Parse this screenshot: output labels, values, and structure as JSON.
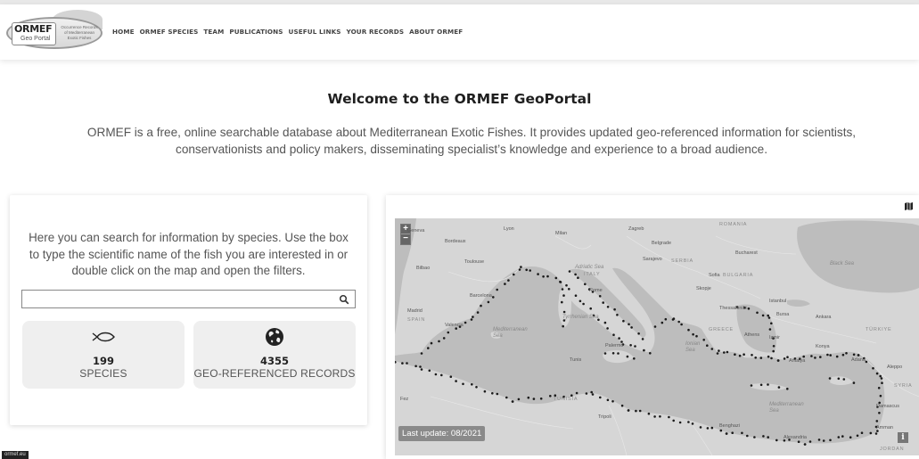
{
  "logo": {
    "name": "ORMEF",
    "subtitle": "Geo Portal",
    "tagline": "Occurrence Records of Mediterranean Exotic Fishes"
  },
  "nav": {
    "items": [
      "HOME",
      "ORMEF SPECIES",
      "TEAM",
      "PUBLICATIONS",
      "USEFUL LINKS",
      "YOUR RECORDS",
      "ABOUT ORMEF"
    ]
  },
  "hero": {
    "title": "Welcome to the ORMEF GeoPortal",
    "intro_line1": "ORMEF is a free, online searchable database about Mediterranean Exotic Fishes. It provides updated geo-referenced information for scientists,",
    "intro_line2": "conservationists and policy makers, disseminating specialist’s knowledge and experience to a broad audience."
  },
  "search_card": {
    "description_line1": "Here you can search for information by species. Use the box",
    "description_line2": "to type the scientific name of the fish you are interested in or",
    "description_line3": "double click on the map and open the filters.",
    "search": {
      "value": "",
      "placeholder": ""
    },
    "stats": [
      {
        "icon": "fish-icon",
        "value": "199",
        "label": "SPECIES"
      },
      {
        "icon": "globe-icon",
        "value": "4355",
        "label": "GEO-REFERENCED RECORDS"
      }
    ]
  },
  "map": {
    "last_update": "Last update: 08/2021",
    "info_button": "i",
    "zoom_in": "+",
    "zoom_out": "−",
    "labels": {
      "lyon": "Lyon",
      "milan": "Milan",
      "zagreb": "Zagreb",
      "romania": "ROMANIA",
      "bordeaux": "Bordeaux",
      "belgrade": "Belgrade",
      "bucharest": "Bucharest",
      "toulouse": "Toulouse",
      "sarajevo": "Sarajevo",
      "serbia": "SERBIA",
      "bilbao": "Bilbao",
      "italy": "ITALY",
      "sofia": "Sofia",
      "bulgaria": "BULGARIA",
      "skopje": "Skopje",
      "rome": "Rome",
      "barcelona": "Barcelona",
      "black_sea": "Black Sea",
      "madrid": "Madrid",
      "spain": "SPAIN",
      "istanbul": "Istanbul",
      "bursa": "Bursa",
      "ankara": "Ankara",
      "valencia": "Valencia",
      "turkiye": "TÜRKIYE",
      "izmir": "Izmir",
      "konya": "Konya",
      "antalya": "Antalya",
      "adana": "Adana",
      "aleppo": "Aleppo",
      "syria": "SYRIA",
      "tunis": "Tunis",
      "palermo": "Palermo",
      "fez": "Fez",
      "tunisia": "TUNISIA",
      "mediterranean_sea": "Mediterranean Sea",
      "damascus": "Damascus",
      "amman": "Amman",
      "jordan": "JORDAN",
      "tripoli": "Tripoli",
      "benghazi": "Benghazi",
      "alexandria": "Alexandria",
      "ionian_sea": "Ionian Sea",
      "thessaloniki": "Thessaloniki",
      "greece": "GREECE",
      "athens": "Athens",
      "adriatic": "Adriatic Sea",
      "tyrrhenian": "Tyrrhenian Sea",
      "mediterranean_w": "Mediterranean Sea",
      "geneva": "Geneva"
    }
  },
  "footer_tip": "ormef.eu"
}
